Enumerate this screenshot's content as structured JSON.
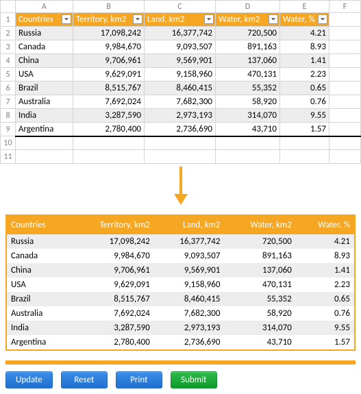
{
  "columns": [
    "",
    "A",
    "B",
    "C",
    "D",
    "E",
    "F"
  ],
  "headers": [
    "Countries",
    "Territory, km2",
    "Land, km2",
    "Water, km2",
    "Water, %"
  ],
  "chart_data": {
    "type": "table",
    "title": "",
    "columns": [
      "Countries",
      "Territory, km2",
      "Land, km2",
      "Water, km2",
      "Water, %"
    ],
    "rows": [
      {
        "country": "Russia",
        "territory": "17,098,242",
        "land": "16,377,742",
        "water": "720,500",
        "pct": "4.21"
      },
      {
        "country": "Canada",
        "territory": "9,984,670",
        "land": "9,093,507",
        "water": "891,163",
        "pct": "8.93"
      },
      {
        "country": "China",
        "territory": "9,706,961",
        "land": "9,569,901",
        "water": "137,060",
        "pct": "1.41"
      },
      {
        "country": "USA",
        "territory": "9,629,091",
        "land": "9,158,960",
        "water": "470,131",
        "pct": "2.23"
      },
      {
        "country": "Brazil",
        "territory": "8,515,767",
        "land": "8,460,415",
        "water": "55,352",
        "pct": "0.65"
      },
      {
        "country": "Australia",
        "territory": "7,692,024",
        "land": "7,682,300",
        "water": "58,920",
        "pct": "0.76"
      },
      {
        "country": "India",
        "territory": "3,287,590",
        "land": "2,973,193",
        "water": "314,070",
        "pct": "9.55"
      },
      {
        "country": "Argentina",
        "territory": "2,780,400",
        "land": "2,736,690",
        "water": "43,710",
        "pct": "1.57"
      }
    ]
  },
  "buttons": {
    "update": "Update",
    "reset": "Reset",
    "print": "Print",
    "submit": "Submit"
  }
}
